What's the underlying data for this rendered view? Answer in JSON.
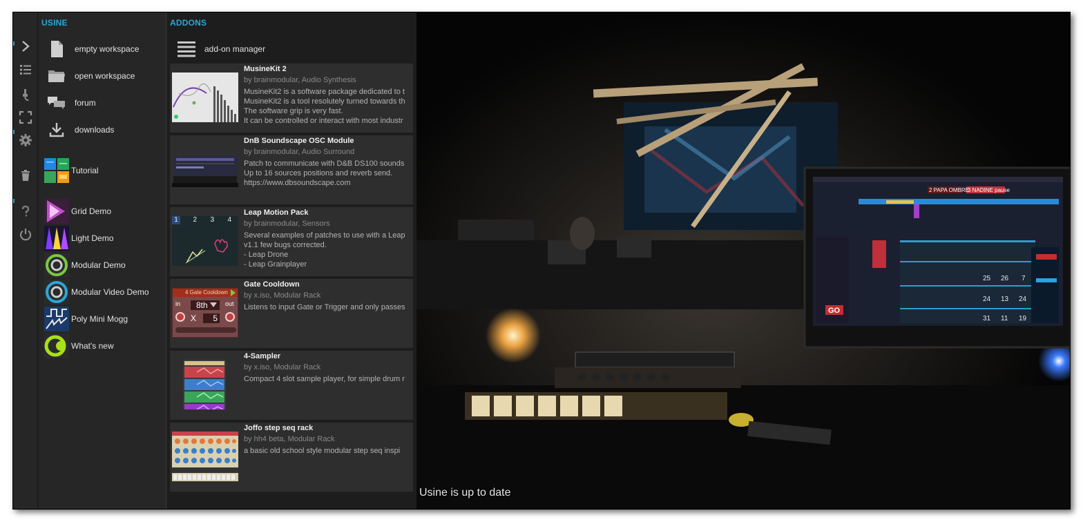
{
  "usine": {
    "title": "USINE",
    "items": [
      {
        "label": "empty workspace",
        "icon": "file-icon"
      },
      {
        "label": "open workspace",
        "icon": "folder-icon"
      },
      {
        "label": "forum",
        "icon": "chat-icon"
      },
      {
        "label": "downloads",
        "icon": "download-icon"
      },
      {
        "label": "Tutorial",
        "icon": "tutorial-icon"
      },
      {
        "label": "Grid Demo",
        "icon": "grid-demo-icon"
      },
      {
        "label": "Light Demo",
        "icon": "light-demo-icon"
      },
      {
        "label": "Modular Demo",
        "icon": "modular-demo-icon"
      },
      {
        "label": "Modular Video Demo",
        "icon": "modular-video-demo-icon"
      },
      {
        "label": "Poly Mini Mogg",
        "icon": "poly-mini-mogg-icon"
      },
      {
        "label": "What's new",
        "icon": "whats-new-icon"
      }
    ]
  },
  "addons": {
    "title": "ADDONS",
    "manager_label": "add-on manager",
    "items": [
      {
        "name": "MusineKit 2",
        "by": "by brainmodular, Audio Synthesis",
        "desc": [
          "MusineKit2 is a software package dedicated to t",
          "MusineKit2 is a tool resolutely turned towards th",
          "The software grip is very fast.",
          "It can be controlled or interact with most industr"
        ]
      },
      {
        "name": "DnB Soundscape OSC Module",
        "by": "by brainmodular, Audio Surround",
        "desc": [
          "Patch to communicate with D&B DS100 sounds",
          "Up to 16 sources positions and reverb send.",
          "https://www.dbsoundscape.com"
        ]
      },
      {
        "name": "Leap Motion Pack",
        "by": "by brainmodular, Sensors",
        "desc": [
          "Several examples of patches to use with a Leap",
          "v1.1 few bugs corrected.",
          "- Leap Drone",
          "- Leap Grainplayer"
        ],
        "thumb_tabs": [
          "1",
          "2",
          "3",
          "4"
        ]
      },
      {
        "name": "Gate Cooldown",
        "by": "by x.iso, Modular Rack",
        "desc": [
          "Listens to input Gate or Trigger and only passes"
        ],
        "thumb_title": "4 Gate Cooldown",
        "thumb_in": "in",
        "thumb_out": "out",
        "thumb_rate": "8th",
        "thumb_x": "X",
        "thumb_val": "5"
      },
      {
        "name": "4-Sampler",
        "by": "by x.iso, Modular Rack",
        "desc": [
          "Compact 4 slot sample player, for simple drum r"
        ]
      },
      {
        "name": "Joffo step seq rack",
        "by": "by hh4 beta, Modular Rack",
        "desc": [
          "a basic old school style modular step seq inspi"
        ]
      }
    ]
  },
  "status": "Usine is up to date",
  "screen": {
    "cue_a": "2 PAPA OMBRE",
    "cue_b": "3 NADINE pause",
    "go": "GO",
    "grid_numbers": [
      "25",
      "26",
      "7",
      "24",
      "13",
      "24",
      "31",
      "11",
      "19"
    ]
  },
  "colors": {
    "accent": "#2aa7d8",
    "panel": "#262626",
    "addon_bg": "#2e2e2e"
  },
  "rail_icons": [
    "chevron-right-icon",
    "list-icon",
    "microphone-icon",
    "fullscreen-icon",
    "gear-icon",
    "trash-icon",
    "help-icon",
    "power-icon"
  ]
}
